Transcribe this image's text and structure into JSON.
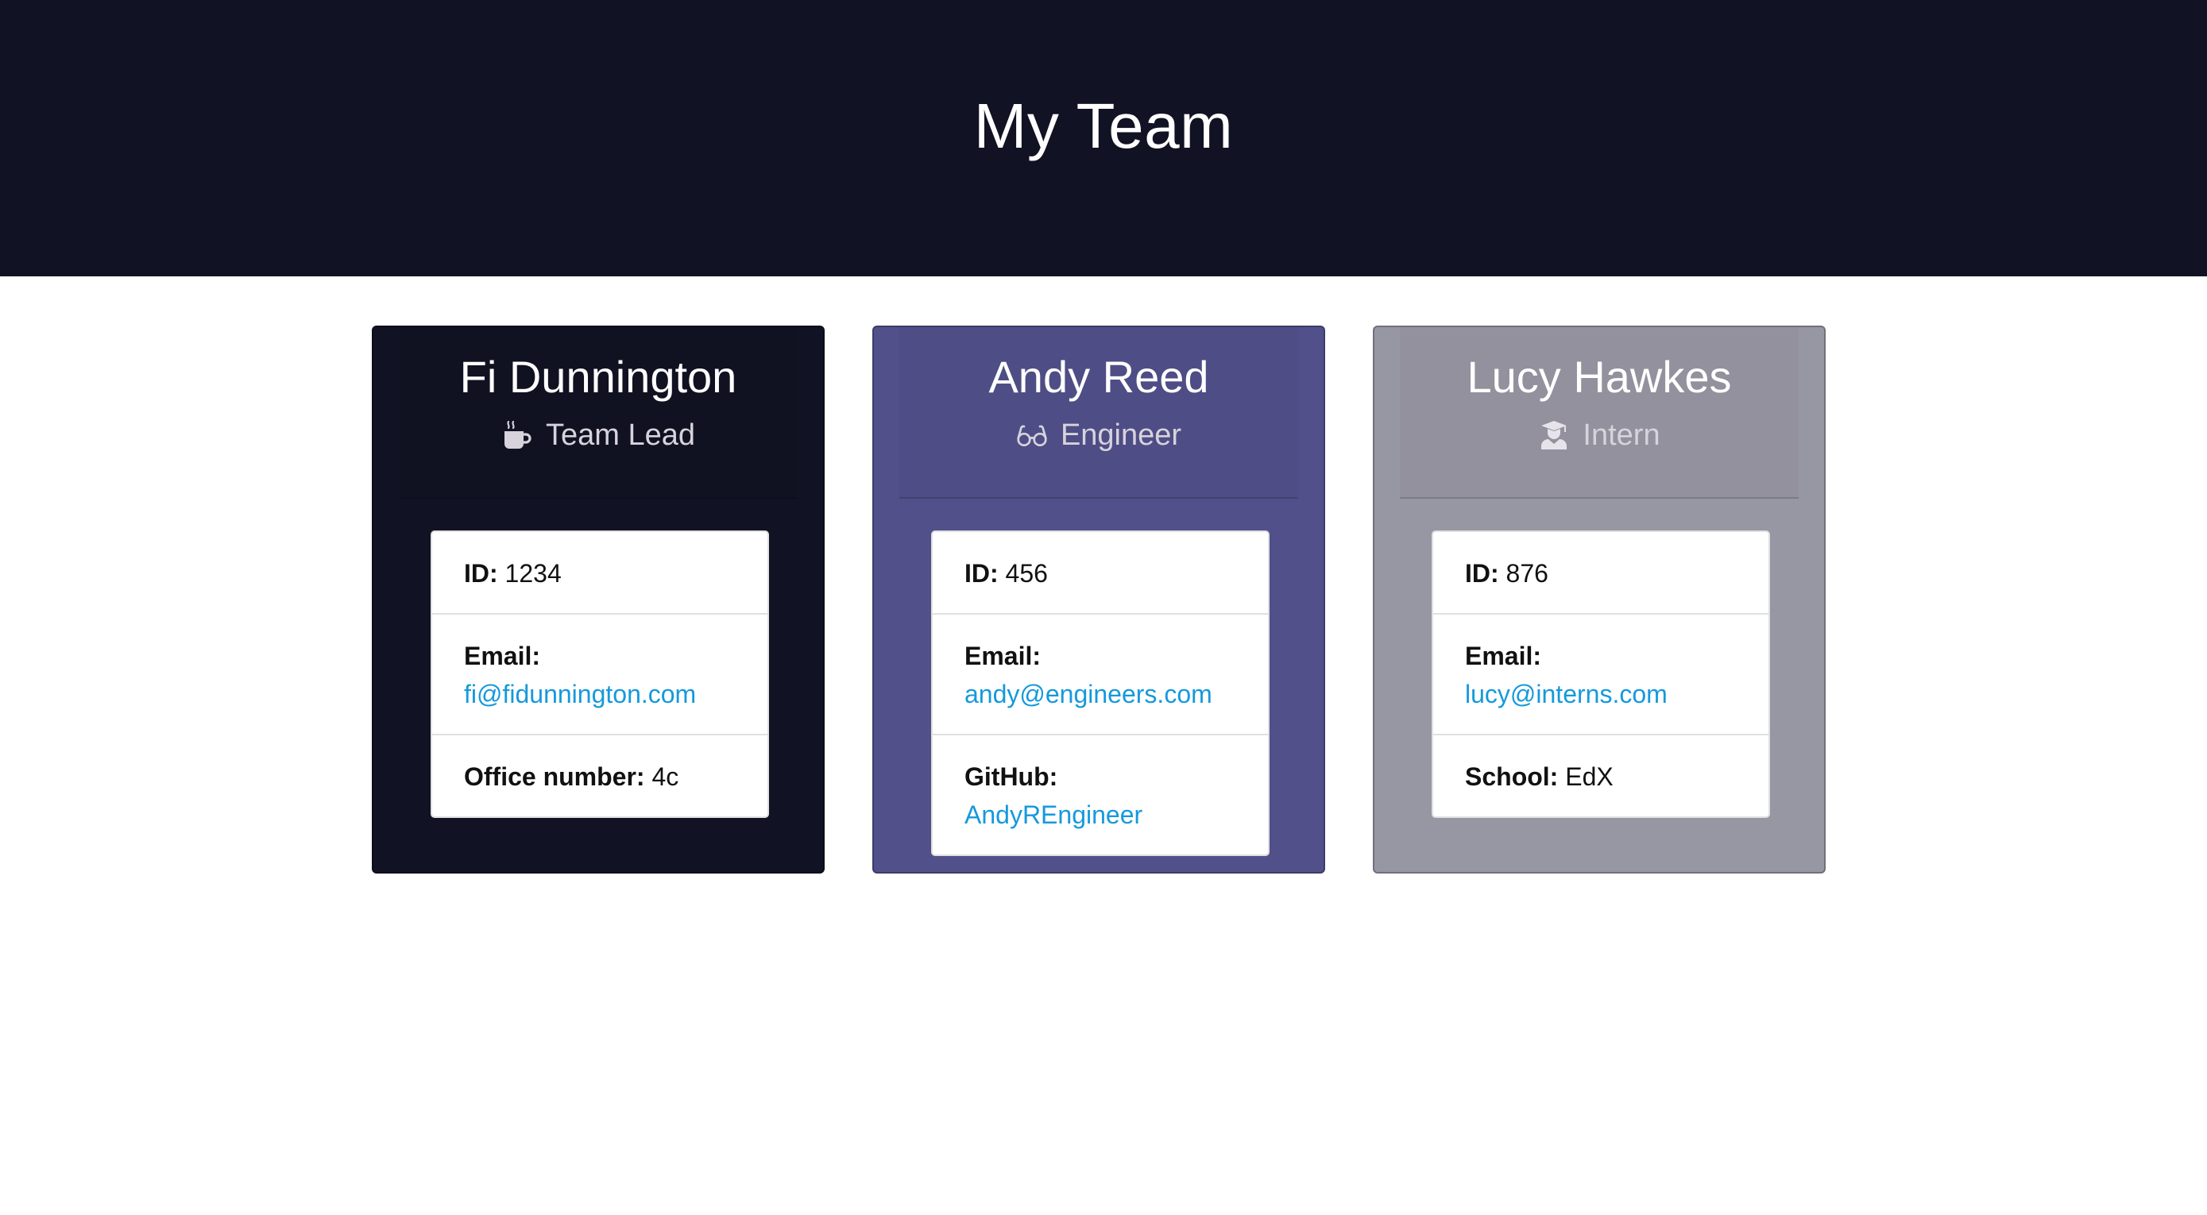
{
  "header": {
    "title": "My Team"
  },
  "colors": {
    "header_bg": "#111324",
    "lead_bg": "#111324",
    "engineer_bg": "#51508a",
    "intern_bg": "#9796a3",
    "link": "#1599dc"
  },
  "team": {
    "manager": {
      "name": "Fi Dunnington",
      "role": "Team Lead",
      "icon": "coffee-mug-icon",
      "id_label": "ID:",
      "id": "1234",
      "email_label": "Email:",
      "email": "fi@fidunnington.com",
      "extra_label": "Office number:",
      "extra_value": "4c"
    },
    "engineer": {
      "name": "Andy Reed",
      "role": "Engineer",
      "icon": "glasses-icon",
      "id_label": "ID:",
      "id": "456",
      "email_label": "Email:",
      "email": "andy@engineers.com",
      "extra_label": "GitHub:",
      "extra_value": "AndyREngineer"
    },
    "intern": {
      "name": "Lucy Hawkes",
      "role": "Intern",
      "icon": "graduate-icon",
      "id_label": "ID:",
      "id": "876",
      "email_label": "Email:",
      "email": "lucy@interns.com",
      "extra_label": "School:",
      "extra_value": "EdX"
    }
  }
}
